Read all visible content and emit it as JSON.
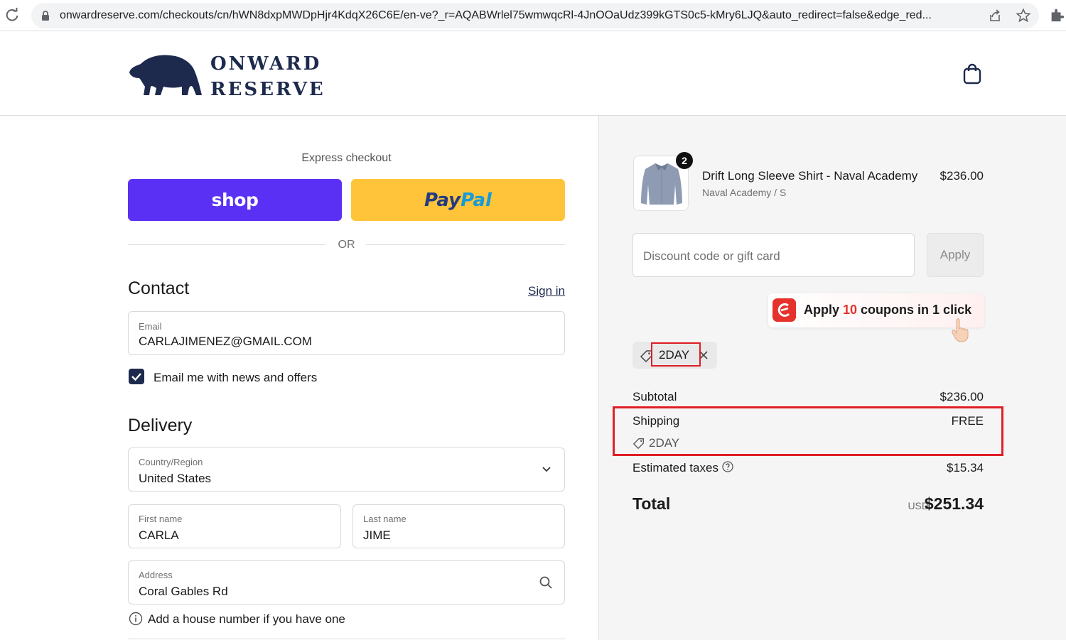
{
  "browser": {
    "url": "onwardreserve.com/checkouts/cn/hWN8dxpMWDpHjr4KdqX26C6E/en-ve?_r=AQABWrlel75wmwqcRl-4JnOOaUdz399kGTS0c5-kMry6LJQ&auto_redirect=false&edge_red..."
  },
  "header": {
    "logo_line1": "ONWARD",
    "logo_line2": "RESERVE"
  },
  "express": {
    "label": "Express checkout",
    "shop_label": "shop",
    "paypal_pay": "Pay",
    "paypal_pal": "Pal",
    "or_label": "OR"
  },
  "contact": {
    "title": "Contact",
    "sign_in": "Sign in",
    "email_label": "Email",
    "email_value": "CARLAJIMENEZ@GMAIL.COM",
    "newsletter_label": "Email me with news and offers",
    "newsletter_checked": true
  },
  "delivery": {
    "title": "Delivery",
    "country_label": "Country/Region",
    "country_value": "United States",
    "first_name_label": "First name",
    "first_name_value": "CARLA",
    "last_name_label": "Last name",
    "last_name_value": "JIME",
    "address_label": "Address",
    "address_value": "Coral Gables Rd",
    "address_hint": "Add a house number if you have one"
  },
  "order": {
    "item": {
      "name": "Drift Long Sleeve Shirt - Naval Academy",
      "variant": "Naval Academy / S",
      "price": "$236.00",
      "quantity": "2"
    },
    "discount_placeholder": "Discount code or gift card",
    "apply_label": "Apply",
    "coupon_banner": {
      "prefix": "Apply ",
      "count": "10",
      "suffix": " coupons in 1 click"
    },
    "applied_code": "2DAY",
    "subtotal_label": "Subtotal",
    "subtotal_value": "$236.00",
    "shipping_label": "Shipping",
    "shipping_value": "FREE",
    "shipping_code": "2DAY",
    "taxes_label": "Estimated taxes",
    "taxes_value": "$15.34",
    "total_label": "Total",
    "total_currency": "USD",
    "total_value": "$251.34"
  },
  "colors": {
    "shop_purple": "#5a31f4",
    "paypal_yellow": "#ffc439",
    "brand_navy": "#1d2a4d",
    "highlight_red": "#e01e26"
  },
  "icons": [
    "reload-icon",
    "lock-icon",
    "share-icon",
    "star-icon",
    "extension-icon",
    "bear-logo",
    "shopping-bag-icon",
    "checkmark-icon",
    "chevron-down-icon",
    "search-icon",
    "info-icon",
    "tag-icon",
    "close-icon",
    "help-icon",
    "coupon-logo-icon",
    "hand-pointer-icon"
  ]
}
